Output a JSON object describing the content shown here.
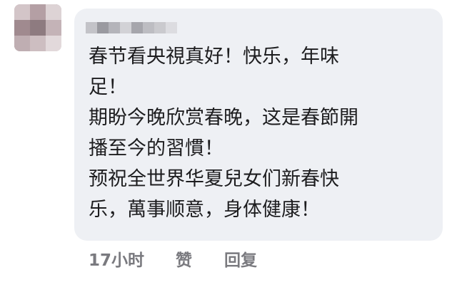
{
  "comment": {
    "text": "春节看央視真好！快乐，年味\n足！\n期盼今晚欣赏春晚，这是春節開\n播至今的習慣！\n预祝全世界华夏兒女们新春快\n乐，萬事顺意，身体健康！"
  },
  "footer": {
    "time": "17小时",
    "like_label": "赞",
    "reply_label": "回复"
  },
  "colors": {
    "bubble_background": "#eef0f4",
    "text_primary": "#1d1d1f",
    "text_secondary": "#7a7a7f"
  }
}
